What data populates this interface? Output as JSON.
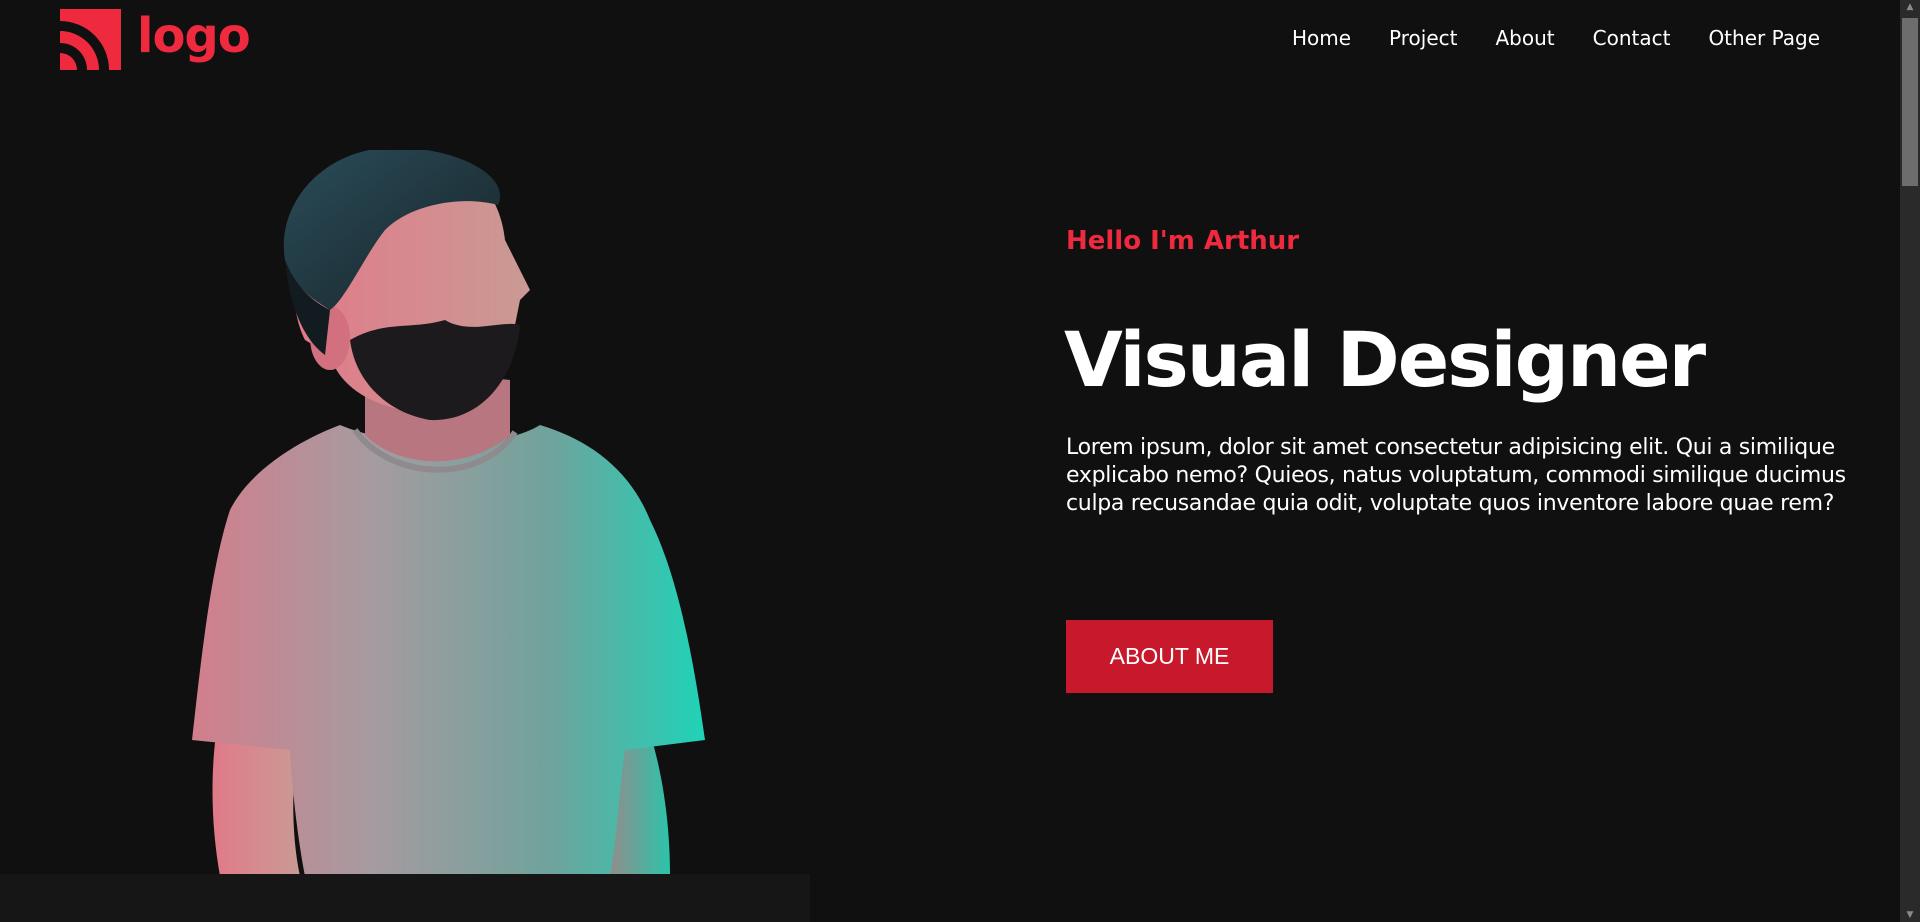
{
  "header": {
    "logo_text": "logo",
    "logo_icon": "rss-arcs-icon",
    "nav": [
      {
        "label": "Home"
      },
      {
        "label": "Project"
      },
      {
        "label": "About"
      },
      {
        "label": "Contact"
      },
      {
        "label": "Other Page"
      }
    ]
  },
  "hero": {
    "greeting": "Hello I'm Arthur",
    "title": "Visual Designer",
    "description": "Lorem ipsum, dolor sit amet consectetur adipisicing elit. Qui a similique explicabo nemo? Quieos, natus voluptatum, commodi similique ducimus culpa recusandae quia odit, voluptate quos inventore labore quae rem?",
    "button_label": "ABOUT ME",
    "photo": "bearded-man-portrait"
  },
  "colors": {
    "background": "#101011",
    "accent": "#ef2a3f",
    "button": "#c8192c",
    "text": "#ffffff",
    "scrollbar_track": "#2a2a2b",
    "scrollbar_thumb": "#6d6d6e"
  }
}
